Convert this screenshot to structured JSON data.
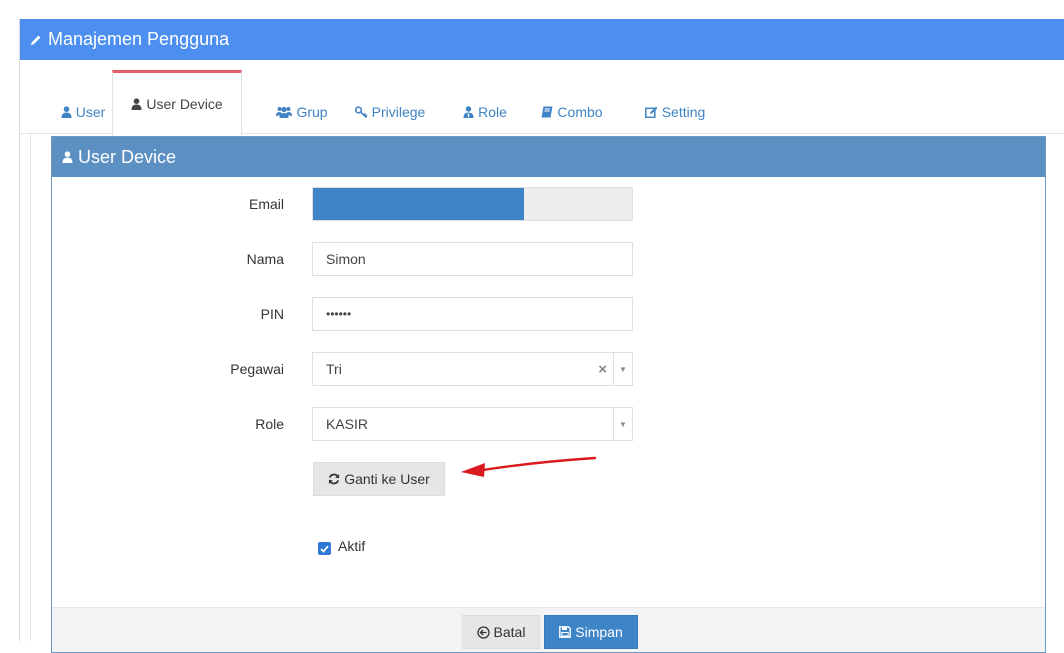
{
  "header": {
    "title": "Manajemen Pengguna",
    "icon": "pencil-icon"
  },
  "tabs": [
    {
      "label": "User",
      "icon": "user-icon"
    },
    {
      "label": "User Device",
      "icon": "user-icon",
      "active": true
    },
    {
      "label": "Grup",
      "icon": "users-icon"
    },
    {
      "label": "Privilege",
      "icon": "key-icon"
    },
    {
      "label": "Role",
      "icon": "user-tie-icon"
    },
    {
      "label": "Combo",
      "icon": "book-icon"
    },
    {
      "label": "Setting",
      "icon": "edit-icon"
    }
  ],
  "panel": {
    "title": "User Device",
    "icon": "user-icon"
  },
  "form": {
    "email": {
      "label": "Email",
      "value": ""
    },
    "nama": {
      "label": "Nama",
      "value": "Simon"
    },
    "pin": {
      "label": "PIN",
      "value": "••••••"
    },
    "pegawai": {
      "label": "Pegawai",
      "value": "Tri",
      "clear": "×",
      "arrow": "▼"
    },
    "role": {
      "label": "Role",
      "value": "KASIR",
      "arrow": "▼"
    },
    "switch_button": "Ganti ke User",
    "aktif_label": "Aktif",
    "aktif_checked": true
  },
  "footer": {
    "cancel_label": "Batal",
    "save_label": "Simpan"
  },
  "colors": {
    "header_bg": "#4c8ff0",
    "panel_header_bg": "#5d90c2",
    "primary": "#3e85c8",
    "active_tab_border": "#e45d6a",
    "annotation_arrow": "#d9191d"
  }
}
